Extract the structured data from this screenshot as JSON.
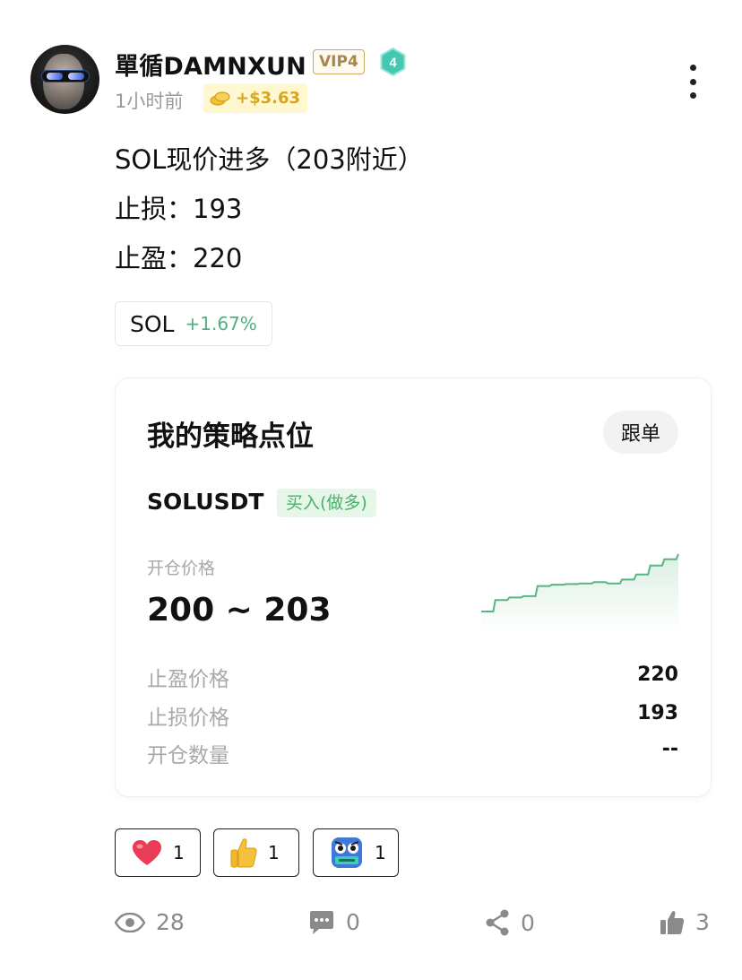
{
  "post": {
    "username": "單循DAMNXUN",
    "vip_badge": "VIP4",
    "level_badge": "4",
    "time": "1小时前",
    "reward": "+$3.63",
    "lines": [
      "SOL现价进多（203附近）",
      "止损：193",
      "止盈：220"
    ],
    "tag": {
      "symbol": "SOL",
      "change": "+1.67%"
    }
  },
  "card": {
    "title": "我的策略点位",
    "follow_button": "跟单",
    "pair": "SOLUSDT",
    "side": "买入(做多)",
    "entry_label": "开仓价格",
    "entry_price": "200 ~ 203",
    "rows": [
      {
        "label": "止盈价格",
        "value": "220"
      },
      {
        "label": "止损价格",
        "value": "193"
      },
      {
        "label": "开仓数量",
        "value": "--"
      }
    ],
    "sparkline": [
      0,
      18,
      22,
      24,
      40,
      42,
      43,
      44,
      46,
      44,
      50,
      58,
      72,
      82,
      90
    ],
    "sparkline_color": "#57b57f"
  },
  "reactions": [
    {
      "icon": "heart-icon",
      "count": "1"
    },
    {
      "icon": "thumbs-up-emoji-icon",
      "count": "1"
    },
    {
      "icon": "hodl-mascot-icon",
      "count": "1"
    }
  ],
  "stats": {
    "views": "28",
    "comments": "0",
    "shares": "0",
    "likes": "3"
  },
  "colors": {
    "accent_green": "#4fb17f",
    "vip_gold": "#a9874c",
    "reward_gold": "#d7a520",
    "level_teal": "#3ec7b0"
  }
}
